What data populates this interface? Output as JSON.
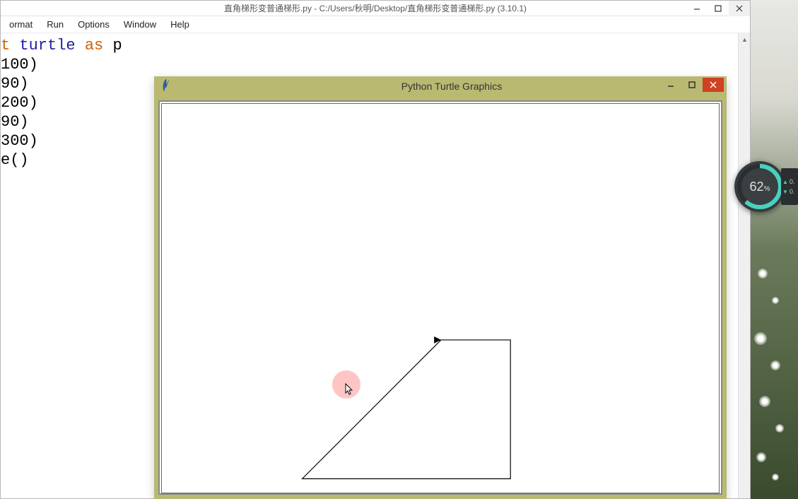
{
  "editor": {
    "title": "直角梯形变普通梯形.py - C:/Users/秋明/Desktop/直角梯形变普通梯形.py (3.10.1)",
    "menu": {
      "format": "ormat",
      "run": "Run",
      "options": "Options",
      "window": "Window",
      "help": "Help"
    },
    "code": {
      "line1_import": "t ",
      "line1_turtle": "turtle ",
      "line1_as": "as ",
      "line1_p": "p",
      "line2": "100)",
      "line3": "90)",
      "line4": "200)",
      "line5": "90)",
      "line6": "300)",
      "line7": "e()"
    }
  },
  "turtle": {
    "title": "Python Turtle Graphics"
  },
  "gauge": {
    "value": "62",
    "pct": "%",
    "up": "0.",
    "down": "0."
  }
}
